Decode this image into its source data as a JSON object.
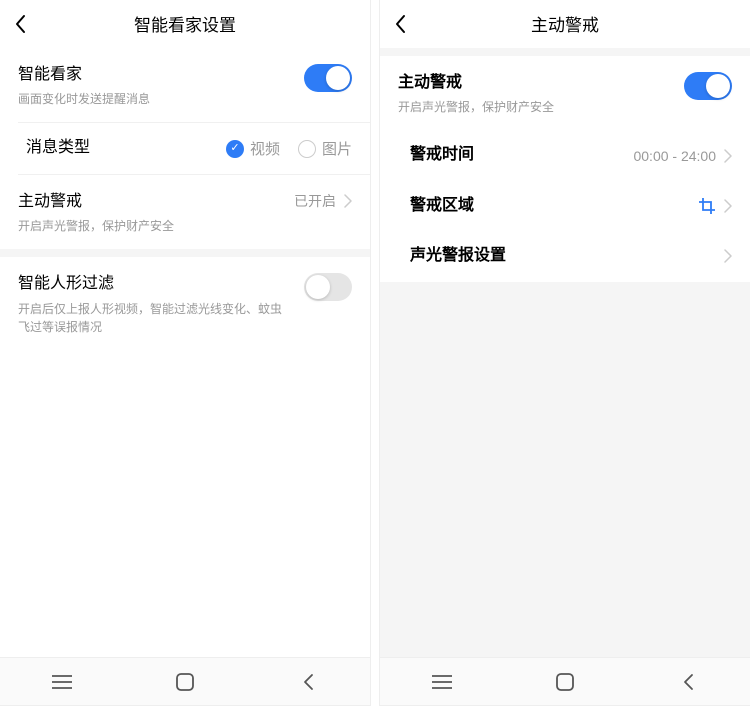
{
  "left": {
    "title": "智能看家设置",
    "smartWatch": {
      "title": "智能看家",
      "sub": "画面变化时发送提醒消息",
      "on": true
    },
    "msgType": {
      "title": "消息类型",
      "options": [
        {
          "label": "视频",
          "selected": true
        },
        {
          "label": "图片",
          "selected": false
        }
      ]
    },
    "activeAlert": {
      "title": "主动警戒",
      "sub": "开启声光警报，保护财产安全",
      "value": "已开启"
    },
    "humanFilter": {
      "title": "智能人形过滤",
      "sub": "开启后仅上报人形视频，智能过滤光线变化、蚊虫飞过等误报情况",
      "on": false
    }
  },
  "right": {
    "title": "主动警戒",
    "alert": {
      "title": "主动警戒",
      "sub": "开启声光警报，保护财产安全",
      "on": true
    },
    "time": {
      "title": "警戒时间",
      "value": "00:00 - 24:00"
    },
    "area": {
      "title": "警戒区域"
    },
    "sound": {
      "title": "声光警报设置"
    }
  }
}
